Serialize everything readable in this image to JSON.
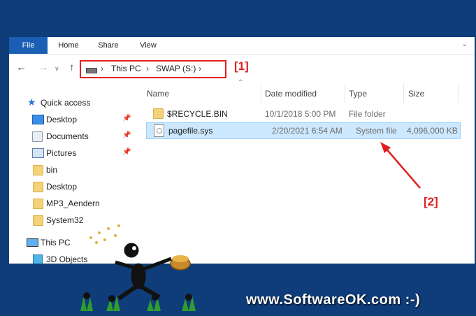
{
  "ribbon": {
    "tabs": [
      "File",
      "Home",
      "Share",
      "View"
    ]
  },
  "address": {
    "crumbs": [
      "This PC",
      "SWAP (S:)"
    ]
  },
  "annotations": {
    "label1": "[1]",
    "label2": "[2]"
  },
  "sidebar": {
    "quick_access": "Quick access",
    "items": [
      {
        "label": "Desktop",
        "icon": "desktop-icon",
        "pinned": true
      },
      {
        "label": "Documents",
        "icon": "documents-icon",
        "pinned": true
      },
      {
        "label": "Pictures",
        "icon": "pictures-icon",
        "pinned": true
      },
      {
        "label": "bin",
        "icon": "folder-icon",
        "pinned": false
      },
      {
        "label": "Desktop",
        "icon": "folder-icon",
        "pinned": false
      },
      {
        "label": "MP3_Aendern",
        "icon": "folder-icon",
        "pinned": false
      },
      {
        "label": "System32",
        "icon": "folder-icon",
        "pinned": false
      }
    ],
    "this_pc": "This PC",
    "objects_3d": "3D Objects"
  },
  "table": {
    "headers": [
      "Name",
      "Date modified",
      "Type",
      "Size"
    ],
    "rows": [
      {
        "name": "$RECYCLE.BIN",
        "date": "10/1/2018 5:00 PM",
        "type": "File folder",
        "size": "",
        "icon": "folder-icon",
        "selected": false
      },
      {
        "name": "pagefile.sys",
        "date": "2/20/2021 6:54 AM",
        "type": "System file",
        "size": "4,096,000 KB",
        "icon": "system-file-icon",
        "selected": true
      }
    ]
  },
  "branding": {
    "text": "www.SoftwareOK.com :-)"
  },
  "colors": {
    "background": "#0e3d7a",
    "file_tab": "#1a5fb4",
    "annotation": "#e21f1f",
    "selection": "#cce8ff"
  }
}
